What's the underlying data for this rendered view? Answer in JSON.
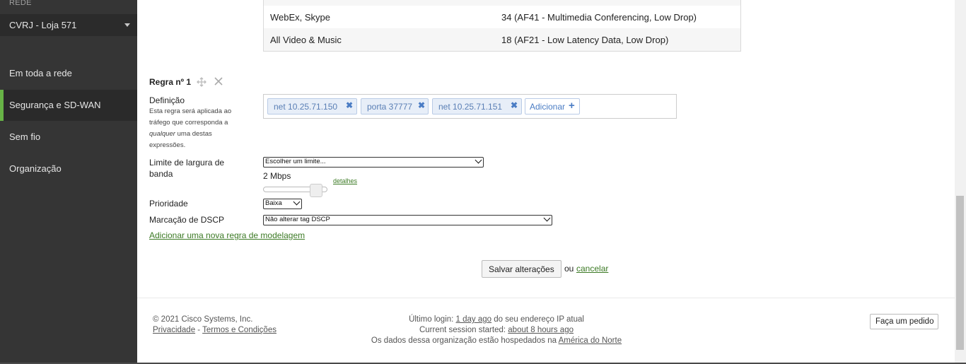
{
  "sidebar": {
    "section_label": "REDE",
    "network_name": "CVRJ - Loja 571",
    "items": [
      {
        "label": "Em toda a rede"
      },
      {
        "label": "Segurança e SD-WAN"
      },
      {
        "label": "Sem fio"
      },
      {
        "label": "Organização"
      }
    ]
  },
  "table": {
    "rows": [
      {
        "app": "",
        "dscp": ""
      },
      {
        "app": "WebEx, Skype",
        "dscp": "34 (AF41 - Multimedia Conferencing, Low Drop)"
      },
      {
        "app": "All Video & Music",
        "dscp": "18 (AF21 - Low Latency Data, Low Drop)"
      }
    ]
  },
  "rule": {
    "title": "Regra nº 1",
    "definition_label": "Definição",
    "definition_hint_1": "Esta regra será aplicada ao tráfego que corresponda a",
    "definition_hint_em": "qualquer",
    "definition_hint_2": "uma destas expressões.",
    "tokens": [
      "net 10.25.71.150",
      "porta 37777",
      "net 10.25.71.151"
    ],
    "add_label": "Adicionar",
    "bandwidth_label": "Limite de largura de banda",
    "bandwidth_select": "Escolher um limite...",
    "bandwidth_value": "2 Mbps",
    "bandwidth_slider_fraction": 0.82,
    "details_link": "detalhes",
    "priority_label": "Prioridade",
    "priority_select": "Baixa",
    "dscp_label": "Marcação de DSCP",
    "dscp_select": "Não alterar tag DSCP",
    "add_rule_link": "Adicionar uma nova regra de modelagem"
  },
  "actions": {
    "save_label": "Salvar alterações",
    "or_text": "ou",
    "cancel_label": "cancelar"
  },
  "footer": {
    "copyright": "© 2021 Cisco Systems, Inc.",
    "privacy": "Privacidade",
    "separator": "-",
    "terms": "Termos e Condições",
    "last_login_prefix": "Último login:",
    "last_login_link": "1 day ago",
    "last_login_suffix": "do seu endereço IP atual",
    "session_prefix": "Current session started:",
    "session_link": "about 8 hours ago",
    "hosted_prefix": "Os dados dessa organização estão hospedados na",
    "hosted_link": "América do Norte",
    "order_button": "Faça um pedido"
  },
  "colors": {
    "sidebar_bg": "#353535",
    "active_accent": "#67b346",
    "link_green": "#3c7a25",
    "token_blue": "#4a7cc4"
  }
}
